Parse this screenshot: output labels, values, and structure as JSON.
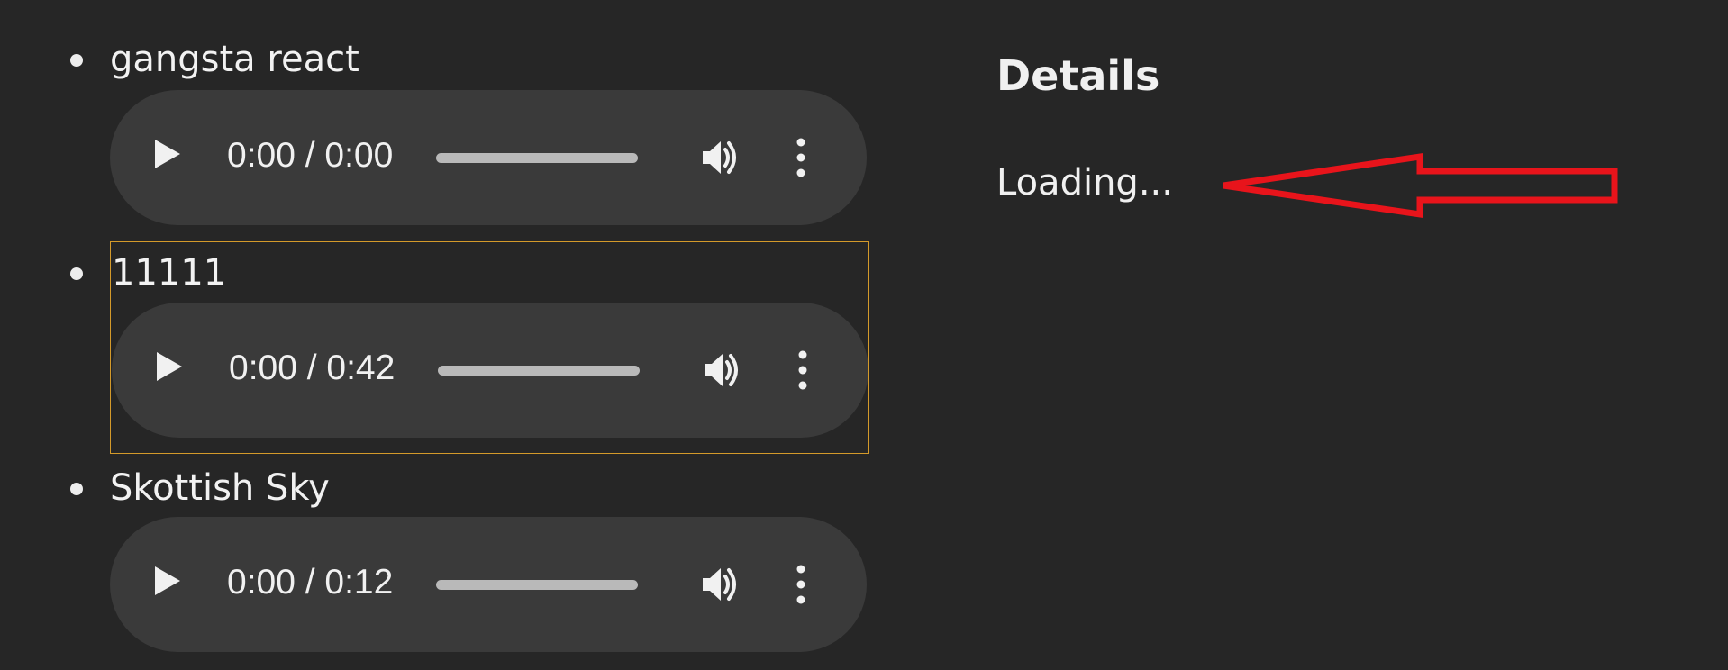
{
  "tracks": [
    {
      "title": "gangsta react",
      "time": "0:00 / 0:00"
    },
    {
      "title": "11111",
      "time": "0:00 / 0:42"
    },
    {
      "title": "Skottish Sky",
      "time": "0:00 / 0:12"
    }
  ],
  "details": {
    "heading": "Details",
    "status": "Loading..."
  },
  "icons": {
    "play": "play-icon",
    "volume": "volume-icon",
    "more": "more-options-icon",
    "annotation": "red-arrow-icon"
  },
  "colors": {
    "background": "#262626",
    "player_bg": "#3a3a3a",
    "focus_outline": "#d49a2a",
    "annotation": "#e8141b"
  }
}
